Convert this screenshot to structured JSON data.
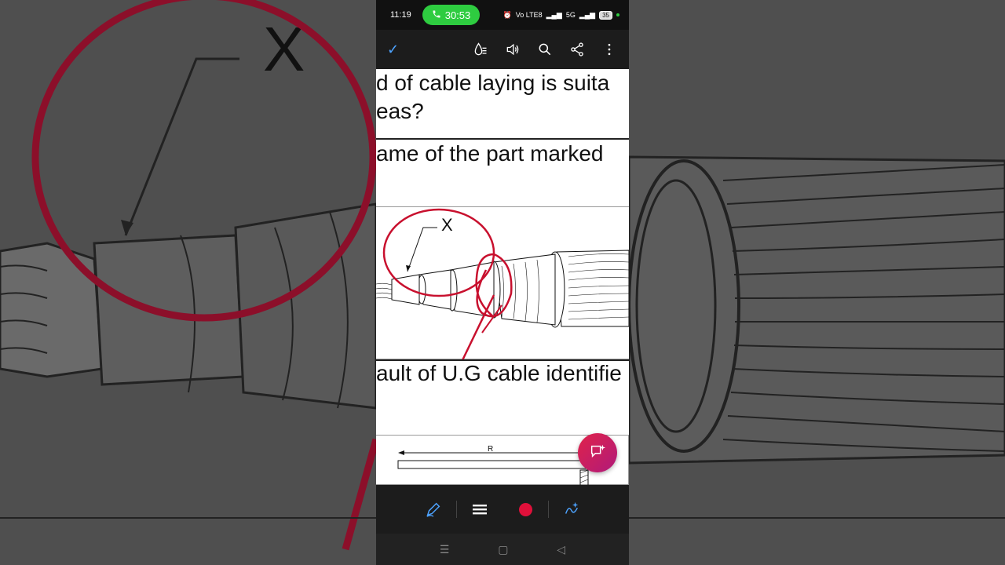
{
  "status": {
    "time": "11:19",
    "call_timer": "30:53",
    "network": "Vo LTE8",
    "net5g": "5G",
    "battery": "35"
  },
  "toolbar": {
    "done_icon": "check-icon",
    "icons": [
      "reading-mode-icon",
      "speaker-icon",
      "search-icon",
      "share-icon",
      "more-icon"
    ]
  },
  "document": {
    "q1_line1": "d of cable laying is suita",
    "q1_line2": "eas?",
    "q2_line1": "ame of the part marked",
    "figure1_label": "X",
    "q3_line1": "ault of U.G cable identifie",
    "figure2_label": "R"
  },
  "background": {
    "label": "X"
  },
  "colors": {
    "accent": "#4da3ff",
    "annotation": "#c8102e",
    "call": "#2ecc40"
  }
}
